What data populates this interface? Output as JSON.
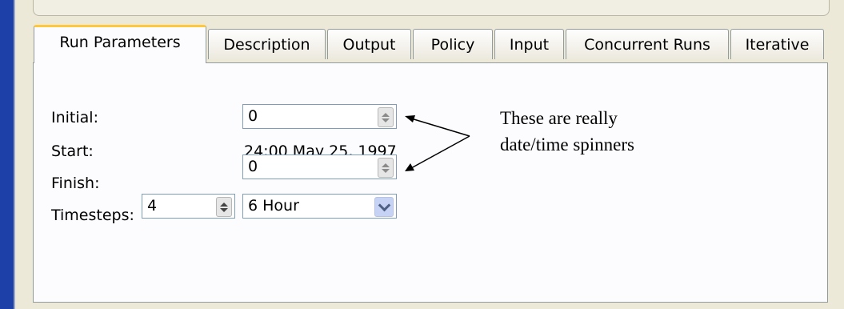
{
  "tabs": [
    "Run Parameters",
    "Description",
    "Output",
    "Policy",
    "Input",
    "Concurrent Runs",
    "Iterative"
  ],
  "form": {
    "initial_label": "Initial:",
    "initial_value": "0",
    "start_label": "Start:",
    "start_value": "24:00 May 25, 1997",
    "finish_label": "Finish:",
    "finish_value": "0",
    "timesteps_label": "Timesteps:",
    "timesteps_value": "4",
    "interval_value": "6 Hour"
  },
  "annotation": {
    "line1": "These are really",
    "line2": "date/time spinners"
  },
  "colors": {
    "background": "#1c3fa8",
    "active_tab_accent": "#ffc83c",
    "dialog": "#ece9d8"
  }
}
